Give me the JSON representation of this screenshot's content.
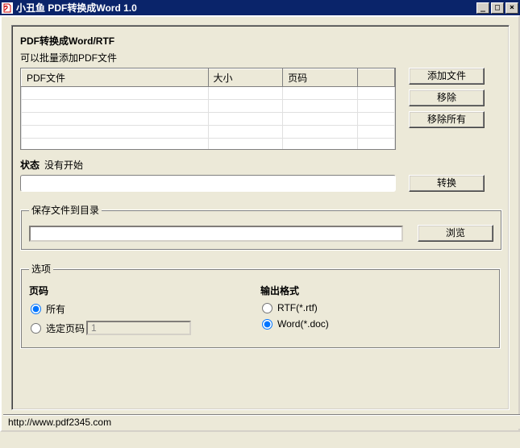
{
  "window": {
    "title": "小丑鱼 PDF转换成Word 1.0"
  },
  "header": {
    "title": "PDF转换成Word/RTF",
    "subtitle": "可以批量添加PDF文件"
  },
  "table": {
    "columns": [
      "PDF文件",
      "大小",
      "页码",
      ""
    ]
  },
  "buttons": {
    "add": "添加文件",
    "remove": "移除",
    "remove_all": "移除所有",
    "convert": "转换",
    "browse": "浏览"
  },
  "status": {
    "label": "状态",
    "value": "没有开始"
  },
  "save_group": {
    "legend": "保存文件到目录",
    "path": ""
  },
  "options_group": {
    "legend": "选项",
    "pages": {
      "title": "页码",
      "all": "所有",
      "selected": "选定页码",
      "selected_value": "1"
    },
    "format": {
      "title": "输出格式",
      "rtf": "RTF(*.rtf)",
      "word": "Word(*.doc)"
    }
  },
  "statusbar": {
    "url": "http://www.pdf2345.com"
  }
}
